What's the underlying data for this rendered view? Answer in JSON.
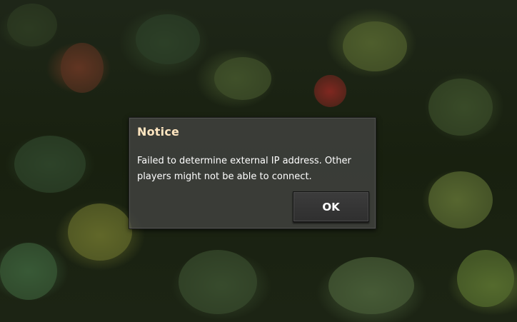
{
  "background": {
    "description_icon": "forest-canopy-background"
  },
  "dialog": {
    "title": "Notice",
    "message": "Failed to determine external IP address. Other players might not be able to connect.",
    "ok_label": "OK"
  },
  "colors": {
    "title": "#ffe6c0",
    "message": "#ffffff",
    "panel": "#464646",
    "button": "#333333"
  }
}
